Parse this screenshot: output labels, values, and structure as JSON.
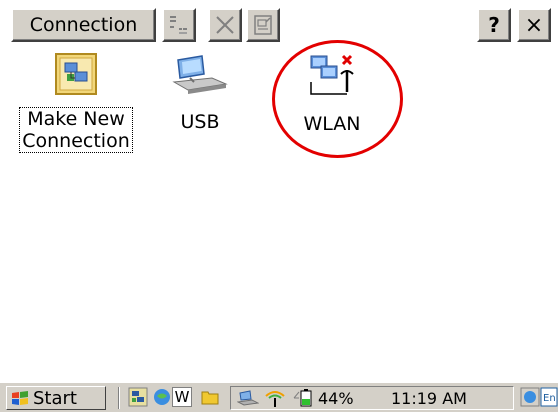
{
  "toolbar": {
    "menu_label": "Connection",
    "help_label": "?",
    "close_label": "×"
  },
  "items": [
    {
      "label_line1": "Make New",
      "label_line2": "Connection",
      "icon": "make-new-connection-icon"
    },
    {
      "label": "USB",
      "icon": "usb-connection-icon"
    },
    {
      "label": "WLAN",
      "icon": "wlan-connection-icon"
    }
  ],
  "taskbar": {
    "start_label": "Start",
    "battery_percent": "44%",
    "clock": "11:19 AM",
    "w_label": "W"
  },
  "colors": {
    "chrome": "#d4d0c8",
    "highlight_circle": "#e30000"
  }
}
